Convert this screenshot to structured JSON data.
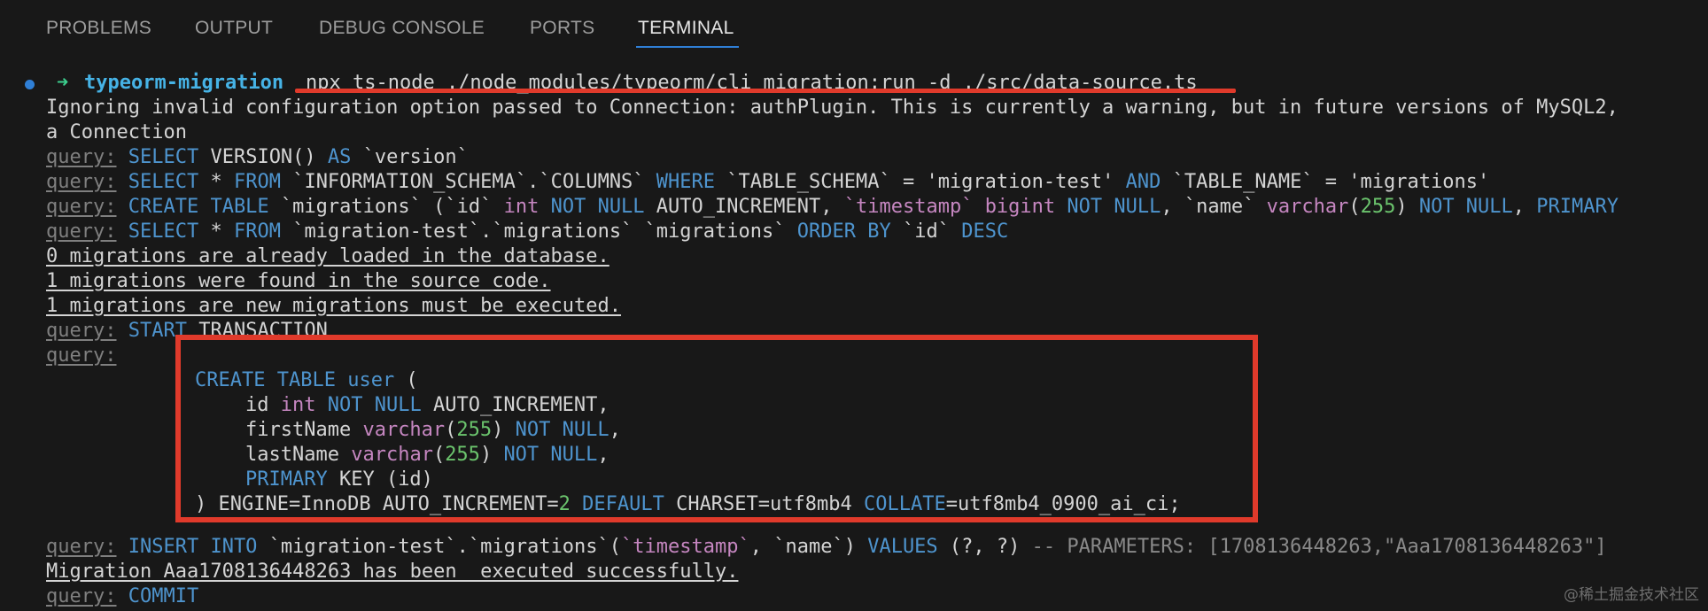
{
  "panel": {
    "tabs": [
      "PROBLEMS",
      "OUTPUT",
      "DEBUG CONSOLE",
      "PORTS",
      "TERMINAL"
    ],
    "active_tab": "TERMINAL"
  },
  "terminal": {
    "prompt": {
      "arrow": "➜",
      "dir": "typeorm-migration",
      "command": "npx ts-node ./node_modules/typeorm/cli migration:run -d ./src/data-source.ts"
    },
    "warning_line1": "Ignoring invalid configuration option passed to Connection: authPlugin. This is currently a warning, but in future versions of MySQL2,",
    "warning_line2": "a Connection",
    "query_label": "query:",
    "q1": {
      "kw1": "SELECT",
      "t1": " VERSION() ",
      "kw2": "AS",
      "t2": " `version`"
    },
    "q2": {
      "kw1": "SELECT",
      "t1": " * ",
      "kw2": "FROM",
      "t2": " `INFORMATION_SCHEMA`.`COLUMNS` ",
      "kw3": "WHERE",
      "t3": " `TABLE_SCHEMA` = 'migration-test' ",
      "kw4": "AND",
      "t4": " `TABLE_NAME` = 'migrations'"
    },
    "q3": {
      "kw1": "CREATE TABLE",
      "t1": " `migrations` (`id` ",
      "ty1": "int",
      "kw2": " NOT NULL",
      "t2": " AUTO_INCREMENT, ",
      "ty2": "`timestamp`",
      "t3": " ",
      "ty3": "bigint",
      "kw3": " NOT NULL",
      "t4": ", `name` ",
      "ty4": "varchar",
      "t5": "(",
      "n1": "255",
      "t6": ") ",
      "kw4": "NOT NULL",
      "t7": ", ",
      "kw5": "PRIMARY"
    },
    "q4": {
      "kw1": "SELECT",
      "t1": " * ",
      "kw2": "FROM",
      "t2": " `migration-test`.`migrations` `migrations` ",
      "kw3": "ORDER BY",
      "t3": " `id` ",
      "kw4": "DESC"
    },
    "info1": "0 migrations are already loaded in the database.",
    "info2": "1 migrations were found in the source code.",
    "info3": "1 migrations are new migrations must be executed.",
    "q5": {
      "kw1": "START",
      "t1": " TRANSACTION"
    },
    "create_user": {
      "l1_kw": "CREATE TABLE",
      "l1_t": " ",
      "l1_typ": "user",
      "l1_t2": " (",
      "l2_t": "id ",
      "l2_typ": "int",
      "l2_kw": " NOT NULL",
      "l2_t2": " AUTO_INCREMENT,",
      "l3_t": "firstName ",
      "l3_typ": "varchar",
      "l3_t2": "(",
      "l3_n": "255",
      "l3_t3": ") ",
      "l3_kw": "NOT NULL",
      "l3_t4": ",",
      "l4_t": "lastName ",
      "l4_typ": "varchar",
      "l4_t2": "(",
      "l4_n": "255",
      "l4_t3": ") ",
      "l4_kw": "NOT NULL",
      "l4_t4": ",",
      "l5_kw": "PRIMARY",
      "l5_t": " KEY (id)",
      "l6_t": ") ENGINE=InnoDB AUTO_INCREMENT=",
      "l6_n": "2",
      "l6_t2": " ",
      "l6_kw": "DEFAULT",
      "l6_t3": " CHARSET=utf8mb4 ",
      "l6_kw2": "COLLATE",
      "l6_t4": "=utf8mb4_0900_ai_ci;"
    },
    "q6": {
      "kw1": "INSERT INTO",
      "t1": " `migration-test`.`migrations`(",
      "ty1": "`timestamp`",
      "t2": ", `name`) ",
      "kw2": "VALUES",
      "t3": " (?, ?) ",
      "p1": "-- PARAMETERS: [1708136448263,\"Aaa1708136448263\"]"
    },
    "success": "Migration Aaa1708136448263 has been  executed successfully.",
    "q7": {
      "kw1": "COMMIT"
    }
  },
  "watermark": "@稀土掘金技术社区",
  "colors": {
    "background": "#181818",
    "keyword": "#4e94ce",
    "type": "#c586c0",
    "number": "#6bc46d",
    "annotation": "#e03a2b",
    "active_tab_underline": "#2f7fd6"
  }
}
